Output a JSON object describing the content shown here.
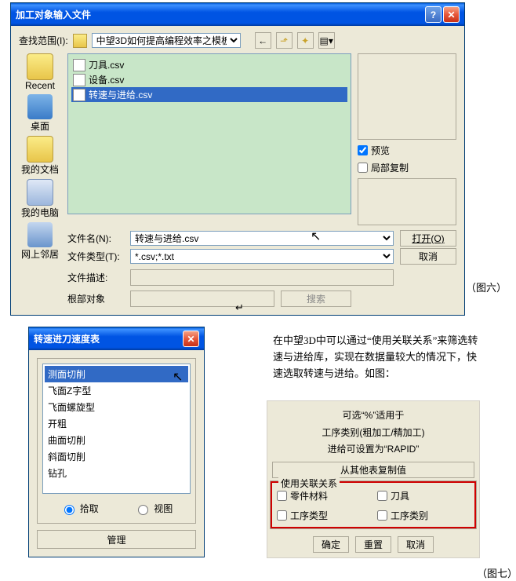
{
  "win1": {
    "title": "加工对象输入文件",
    "lookin_label": "查找范围(I):",
    "lookin_value": "中望3D如何提高编程效率之模板定制",
    "sidebar": [
      "Recent",
      "桌面",
      "我的文档",
      "我的电脑",
      "网上邻居"
    ],
    "files": [
      "刀具.csv",
      "设备.csv",
      "转速与进给.csv"
    ],
    "preview_label": "预览",
    "local_copy_label": "局部复制",
    "filename_label": "文件名(N):",
    "filename_value": "转速与进给.csv",
    "filetype_label": "文件类型(T):",
    "filetype_value": "*.csv;*.txt",
    "filedesc_label": "文件描述:",
    "rootobj_label": "根部对象",
    "search_btn": "搜索",
    "open_btn": "打开(O)",
    "cancel_btn": "取消"
  },
  "caption1": "（图六）",
  "win2": {
    "title": "转速进刀速度表",
    "items": [
      "测面切削",
      "飞面Z字型",
      "飞面螺旋型",
      "开粗",
      "曲面切削",
      "斜面切削",
      "钻孔"
    ],
    "radio_pick": "拾取",
    "radio_view": "视图",
    "manage_btn": "管理"
  },
  "para": "在中望3D中可以通过“使用关联关系”来筛选转速与进给库，实现在数据量较大的情况下，快速选取转速与进给。如图：",
  "panel3": {
    "line1": "可选“%”适用于",
    "line2": "工序类别(粗加工/精加工)",
    "line3": "进给可设置为“RAPID”",
    "copy_btn": "从其他表复制值",
    "group_label": "使用关联关系",
    "c1": "零件材料",
    "c2": "刀具",
    "c3": "工序类型",
    "c4": "工序类别",
    "ok": "确定",
    "reset": "重置",
    "cancel": "取消"
  },
  "caption2": "（图七）"
}
